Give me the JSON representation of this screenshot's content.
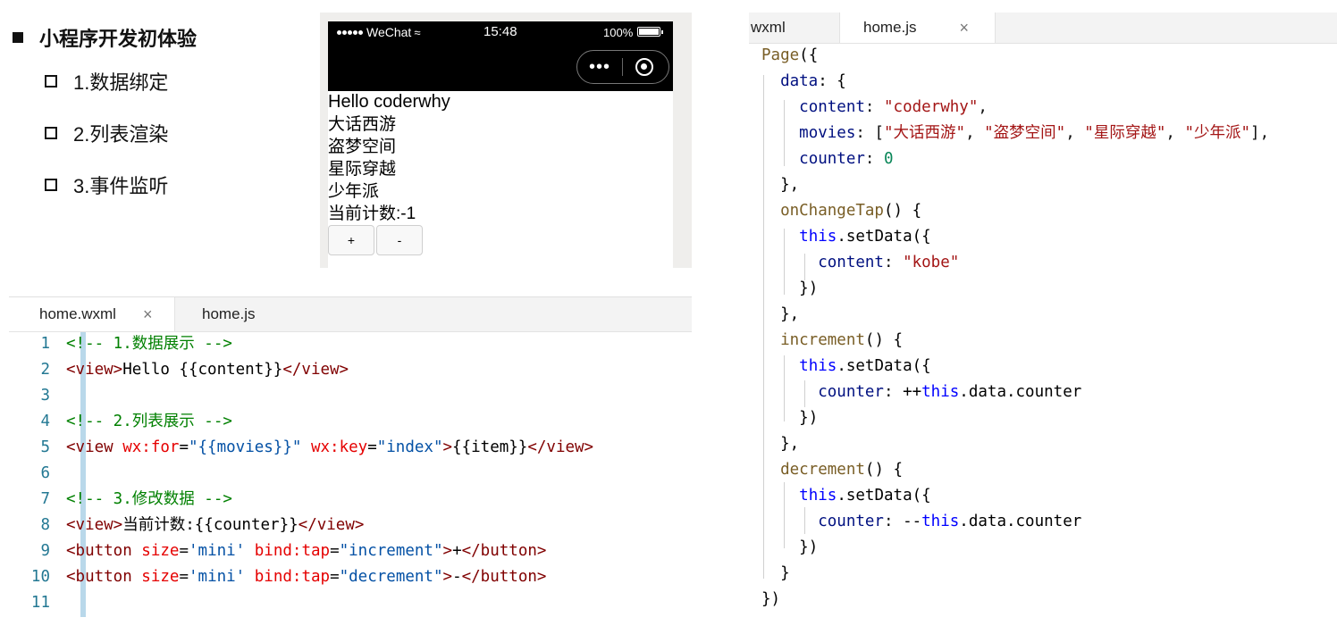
{
  "outline": {
    "title": "小程序开发初体验",
    "items": [
      {
        "label": "1.数据绑定"
      },
      {
        "label": "2.列表渲染"
      },
      {
        "label": "3.事件监听"
      }
    ]
  },
  "phone": {
    "carrier": "WeChat",
    "time": "15:48",
    "battery": "100%",
    "greeting": "Hello coderwhy",
    "movies": [
      "大话西游",
      "盗梦空间",
      "星际穿越",
      "少年派"
    ],
    "counter_text": "当前计数:-1",
    "increment_label": "+",
    "decrement_label": "-"
  },
  "wxml_editor": {
    "tabs": [
      {
        "label": "home.wxml",
        "active": true,
        "close": "×"
      },
      {
        "label": "home.js",
        "active": false
      }
    ],
    "line_numbers": [
      "1",
      "2",
      "3",
      "4",
      "5",
      "6",
      "7",
      "8",
      "9",
      "10",
      "11"
    ],
    "code": {
      "l1_comment": "<!-- 1.数据展示 -->",
      "l2_open": "<view>",
      "l2_text": "Hello {{content}}",
      "l2_close": "</view>",
      "l4_comment": "<!-- 2.列表展示 -->",
      "l5_open": "<view ",
      "l5_attr1": "wx:for",
      "l5_eq1": "=",
      "l5_val1": "\"{{movies}}\"",
      "l5_attr2": "wx:key",
      "l5_eq2": "=",
      "l5_val2": "\"index\"",
      "l5_gt": ">",
      "l5_text": "{{item}}",
      "l5_close": "</view>",
      "l7_comment": "<!-- 3.修改数据 -->",
      "l8_open": "<view>",
      "l8_text": "当前计数:{{counter}}",
      "l8_close": "</view>",
      "l9_open": "<button ",
      "l9_attr1": "size",
      "l9_val1": "'mini'",
      "l9_attr2": "bind:tap",
      "l9_val2": "\"increment\"",
      "l9_text": "+",
      "l9_close": "</button>",
      "l10_open": "<button ",
      "l10_attr1": "size",
      "l10_val1": "'mini'",
      "l10_attr2": "bind:tap",
      "l10_val2": "\"decrement\"",
      "l10_text": "-",
      "l10_close": "</button>"
    }
  },
  "js_editor": {
    "tabs": [
      {
        "label": "wxml",
        "active": false
      },
      {
        "label": "home.js",
        "active": true,
        "close": "×"
      }
    ],
    "code": {
      "page_fn": "Page",
      "page_open": "({",
      "data_key": "data",
      "data_open": ": {",
      "content_key": "content",
      "content_val": "\"coderwhy\"",
      "movies_key": "movies",
      "movie_1": "\"大话西游\"",
      "movie_2": "\"盗梦空间\"",
      "movie_3": "\"星际穿越\"",
      "movie_4": "\"少年派\"",
      "counter_key": "counter",
      "counter_val": "0",
      "close_comma": "},",
      "onchange_fn": "onChangeTap",
      "fn_sig": "() {",
      "this_kw": "this",
      "setdata": ".setData({",
      "kobe_val": "\"kobe\"",
      "close_call": "})",
      "increment_fn": "increment",
      "incr_expr_pre": "++",
      "data_counter": ".data.counter",
      "decrement_fn": "decrement",
      "decr_expr_pre": "--",
      "close_brace": "}",
      "close_page": "})"
    }
  }
}
